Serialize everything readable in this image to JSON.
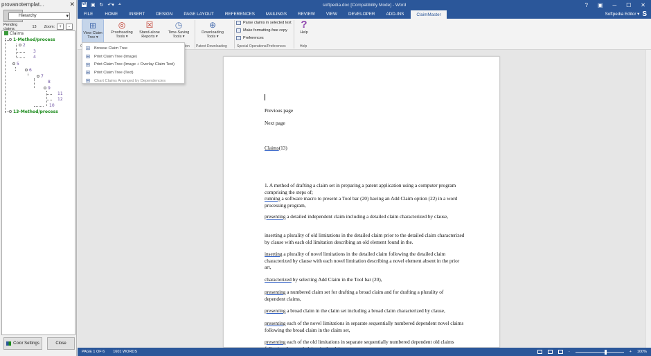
{
  "left_panel": {
    "title": "provanotemplat...",
    "close": "✕",
    "select_value": "Hierarchy",
    "pending_label": "Pending claims:",
    "pending_count": "13",
    "zoom_label": "Zoom:",
    "zoom_plus": "+",
    "zoom_minus": "-",
    "tree": {
      "root": "Claims",
      "nodes": [
        "1-Method/process",
        "2",
        "3",
        "4",
        "5",
        "6",
        "7",
        "8",
        "9",
        "11",
        "12",
        "10",
        "13-Method/process"
      ]
    },
    "color_settings": "Color Settings",
    "close_button": "Close"
  },
  "titlebar": {
    "title": "softpedia.doc [Compatibility Mode] - Word",
    "minimize": "─",
    "maximize": "☐",
    "close": "✕",
    "help": "?"
  },
  "tabs": [
    "FILE",
    "HOME",
    "INSERT",
    "DESIGN",
    "PAGE LAYOUT",
    "REFERENCES",
    "MAILINGS",
    "REVIEW",
    "VIEW",
    "DEVELOPER",
    "ADD-INS",
    "ClaimMaster"
  ],
  "user": {
    "name": "Softpedia Editor ▾",
    "badge": "S"
  },
  "ribbon": {
    "view_claim_tree": [
      "View Claim",
      "Tree ▾"
    ],
    "proofreading": [
      "Proofreading",
      "Tools ▾"
    ],
    "standalone": [
      "Stand-alone",
      "Reports ▾"
    ],
    "timesaving": [
      "Time-Saving",
      "Tools ▾"
    ],
    "downloading": [
      "Downloading",
      "Tools ▾"
    ],
    "help": "Help",
    "parse": "Parse claims in selected text",
    "formatting": "Make formatting-free copy",
    "preferences": "Preferences",
    "groups": {
      "a": "C",
      "b": "ation",
      "c": "Patent Downloading",
      "d": "Special Operations/Preferences",
      "e": "Help"
    }
  },
  "dropdown": [
    "Browse Claim Tree",
    "Print Claim Tree (Image)",
    "Print Claim Tree (Image + Overlay Claim Text)",
    "Print Claim Tree (Text)",
    "Chart Claims Arranged by Dependencies"
  ],
  "document": {
    "prev_page": "Previous page",
    "next_page": "Next page",
    "claims_heading": "Claims",
    "claims_count": "(13)",
    "p1": "1. A method of drafting a claim set in preparing a patent application using a computer program comprising the steps of;",
    "p1b_u": "running",
    "p1b": " a software macro to present a Tool bar (20) having an Add Claim option (22) in a word processing program,",
    "p2_u": "presenting",
    "p2": " a detailed independent claim including a detailed claim characterized by clause,",
    "p3": "inserting a plurality of old limitations in the detailed claim prior to the detailed claim characterized by clause with each old limitation describing an old element found in the.",
    "p4_u": "inserting",
    "p4": " a plurality of novel limitations in the detailed claim following the detailed claim characterized by clause with each novel limitation describing a novel element absent in the prior art,",
    "p5_u": "characterized",
    "p5": " by selecting Add Claim in the Tool bar (20),",
    "p6_u": "presenting",
    "p6": " a numbered claim set for drafting a broad claim and for drafting a plurality of dependent claims,",
    "p7_u": "presenting",
    "p7": " a broad claim in the claim set including a broad claim characterized by clause,",
    "p8_u": "presenting",
    "p8": " each of the novel limitations in separate sequentially numbered dependent novel claims following the broad claim in the claim set,",
    "p9_u": "presenting",
    "p9": " each of the old limitations in separate sequentially numbered dependent old claims following the novel claims in the claim set,"
  },
  "statusbar": {
    "page": "PAGE 1 OF 6",
    "words": "1601 WORDS",
    "zoom": "100%",
    "minus": "-",
    "plus": "+"
  },
  "colors": {
    "word_blue": "#2b579a",
    "tree_green": "#1a8a1a"
  }
}
